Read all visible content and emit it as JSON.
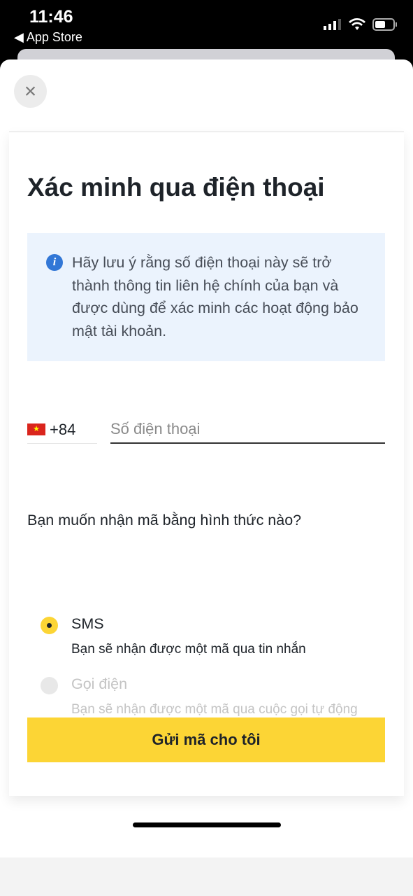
{
  "status_bar": {
    "time": "11:46",
    "back_label": "◀ App Store"
  },
  "close_icon": "×",
  "title": "Xác minh qua điện thoại",
  "info": {
    "icon": "i",
    "text": "Hãy lưu ý rằng số điện thoại này sẽ trở thành thông tin liên hệ chính của bạn và được dùng để xác minh các hoạt động bảo mật tài khoản."
  },
  "phone": {
    "country_code": "+84",
    "flag": "★",
    "placeholder": "Số điện thoại",
    "value": ""
  },
  "question": "Bạn muốn nhận mã bằng hình thức nào?",
  "options": [
    {
      "label": "SMS",
      "description": "Bạn sẽ nhận được một mã qua tin nhắn",
      "selected": true,
      "enabled": true
    },
    {
      "label": "Gọi điện",
      "description": "Bạn sẽ nhận được một mã qua cuộc gọi tự động",
      "selected": false,
      "enabled": false
    }
  ],
  "submit_label": "Gửi mã cho tôi",
  "colors": {
    "accent": "#fcd535",
    "info_bg": "#ebf3fd",
    "info_icon": "#3277d6"
  }
}
